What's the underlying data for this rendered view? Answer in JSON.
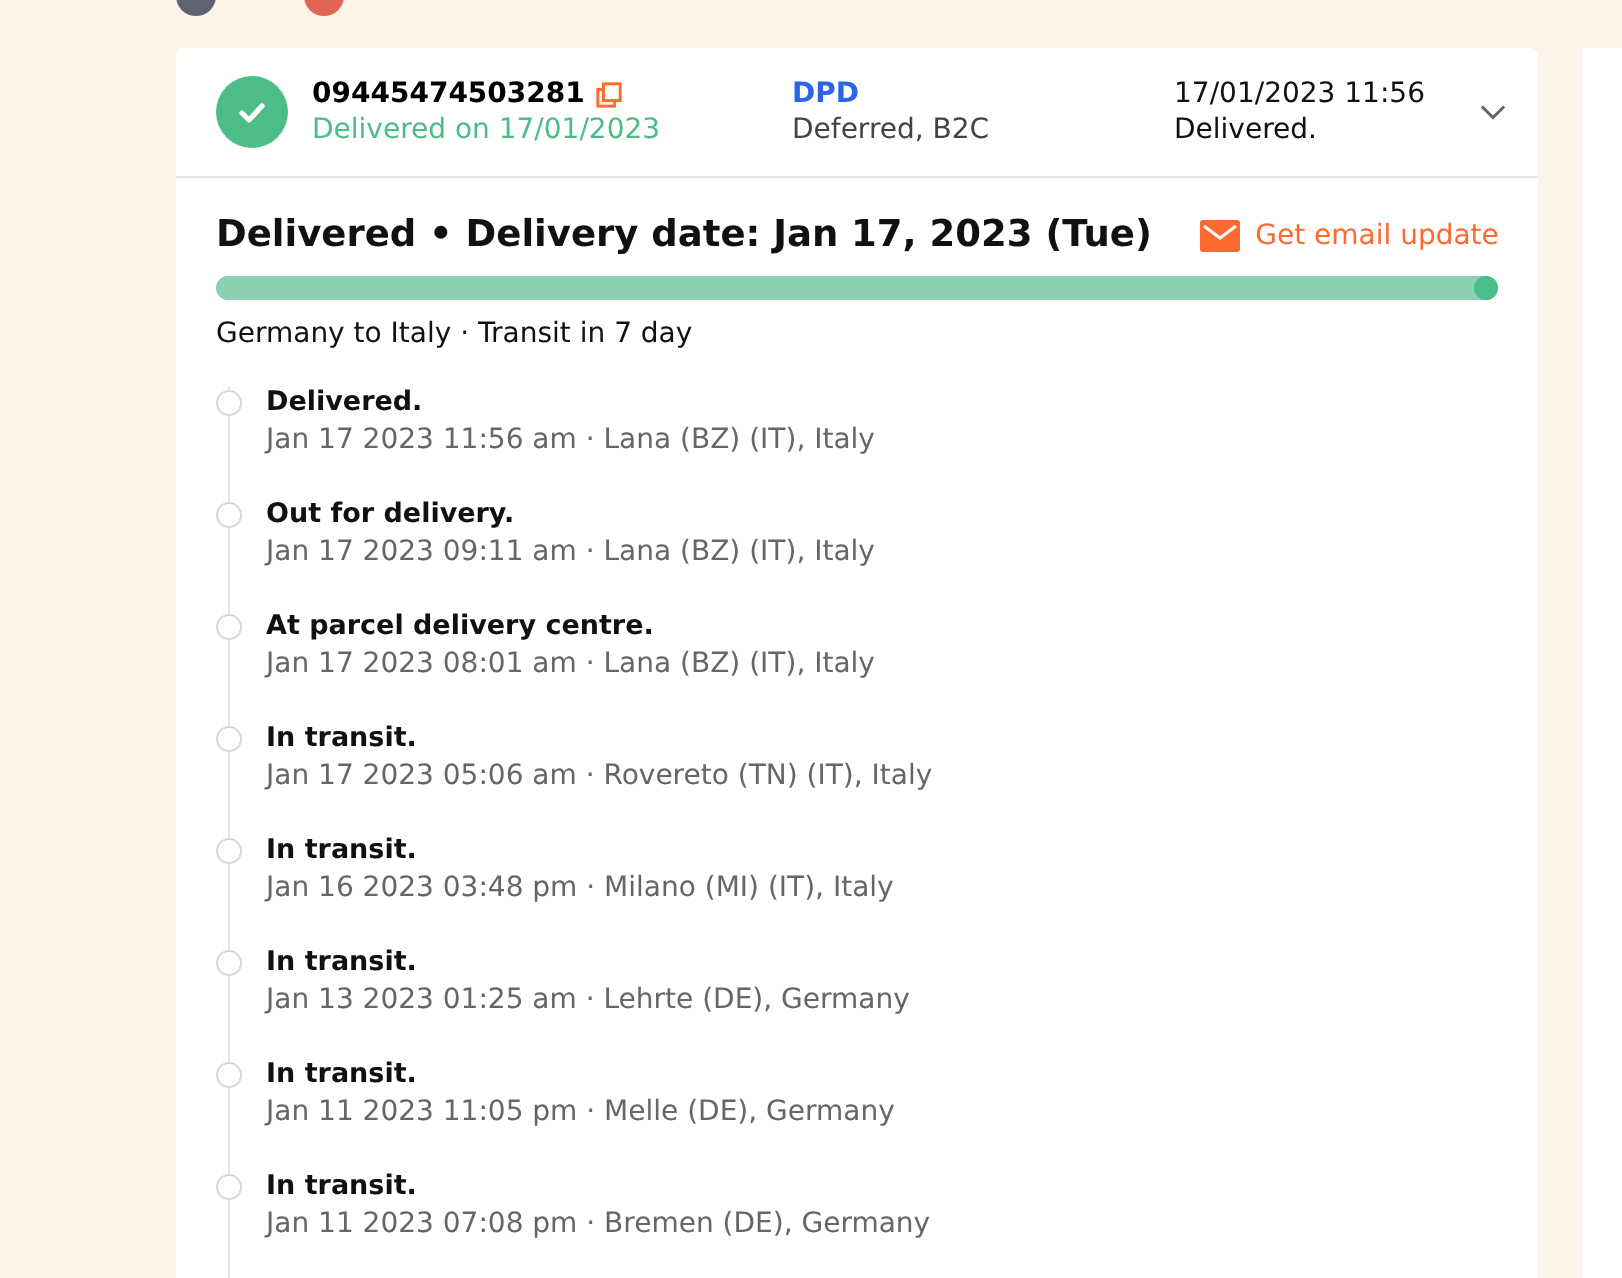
{
  "shipment": {
    "tracking_number": "09445474503281",
    "status_line": "Delivered on 17/01/2023",
    "carrier": "DPD",
    "service": "Deferred, B2C",
    "last_time": "17/01/2023 11:56",
    "last_status": "Delivered.",
    "expanded": true
  },
  "summary": {
    "title": "Delivered • Delivery date: Jan 17, 2023 (Tue)",
    "email_link": "Get email update",
    "level": 1,
    "route": "Germany to Italy · Transit in 7 day"
  },
  "events": [
    {
      "status": "Delivered.",
      "detail": "Jan 17 2023 11:56 am · Lana (BZ) (IT), Italy"
    },
    {
      "status": "Out for delivery.",
      "detail": "Jan 17 2023 09:11 am · Lana (BZ) (IT), Italy"
    },
    {
      "status": "At parcel delivery centre.",
      "detail": "Jan 17 2023 08:01 am · Lana (BZ) (IT), Italy"
    },
    {
      "status": "In transit.",
      "detail": "Jan 17 2023 05:06 am · Rovereto (TN) (IT), Italy"
    },
    {
      "status": "In transit.",
      "detail": "Jan 16 2023 03:48 pm · Milano (MI) (IT), Italy"
    },
    {
      "status": "In transit.",
      "detail": "Jan 13 2023 01:25 am · Lehrte (DE), Germany"
    },
    {
      "status": "In transit.",
      "detail": "Jan 11 2023 11:05 pm · Melle (DE), Germany"
    },
    {
      "status": "In transit.",
      "detail": "Jan 11 2023 07:08 pm · Bremen (DE), Germany"
    }
  ]
}
